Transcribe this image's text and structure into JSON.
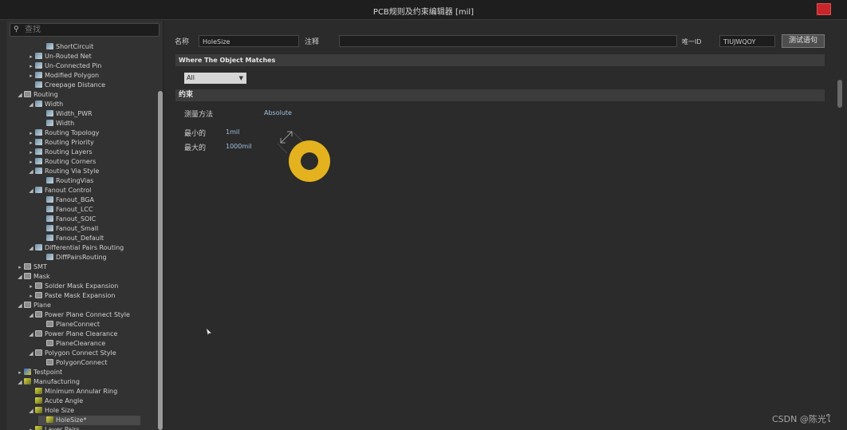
{
  "window": {
    "title": "PCB规则及约束编辑器 [mil]"
  },
  "search": {
    "placeholder": "查找"
  },
  "tree": [
    {
      "label": "ShortCircuit",
      "level": 3,
      "icon": "rule-icon",
      "arrow": ""
    },
    {
      "label": "Un-Routed Net",
      "level": 2,
      "icon": "rule-icon",
      "arrow": "▸"
    },
    {
      "label": "Un-Connected Pin",
      "level": 2,
      "icon": "rule-icon",
      "arrow": "▸"
    },
    {
      "label": "Modified Polygon",
      "level": 2,
      "icon": "rule-icon",
      "arrow": "▸"
    },
    {
      "label": "Creepage Distance",
      "level": 2,
      "icon": "rule-icon",
      "arrow": ""
    },
    {
      "label": "Routing",
      "level": 1,
      "icon": "routing-icon",
      "arrow": "◢"
    },
    {
      "label": "Width",
      "level": 2,
      "icon": "rule-icon",
      "arrow": "◢"
    },
    {
      "label": "Width_PWR",
      "level": 3,
      "icon": "rule-icon",
      "arrow": ""
    },
    {
      "label": "Width",
      "level": 3,
      "icon": "rule-icon",
      "arrow": ""
    },
    {
      "label": "Routing Topology",
      "level": 2,
      "icon": "rule-icon",
      "arrow": "▸"
    },
    {
      "label": "Routing Priority",
      "level": 2,
      "icon": "rule-icon",
      "arrow": "▸"
    },
    {
      "label": "Routing Layers",
      "level": 2,
      "icon": "rule-icon",
      "arrow": "▸"
    },
    {
      "label": "Routing Corners",
      "level": 2,
      "icon": "rule-icon",
      "arrow": "▸"
    },
    {
      "label": "Routing Via Style",
      "level": 2,
      "icon": "rule-icon",
      "arrow": "◢"
    },
    {
      "label": "RoutingVias",
      "level": 3,
      "icon": "rule-icon",
      "arrow": ""
    },
    {
      "label": "Fanout Control",
      "level": 2,
      "icon": "rule-icon",
      "arrow": "◢"
    },
    {
      "label": "Fanout_BGA",
      "level": 3,
      "icon": "rule-icon",
      "arrow": ""
    },
    {
      "label": "Fanout_LCC",
      "level": 3,
      "icon": "rule-icon",
      "arrow": ""
    },
    {
      "label": "Fanout_SOIC",
      "level": 3,
      "icon": "rule-icon",
      "arrow": ""
    },
    {
      "label": "Fanout_Small",
      "level": 3,
      "icon": "rule-icon",
      "arrow": ""
    },
    {
      "label": "Fanout_Default",
      "level": 3,
      "icon": "rule-icon",
      "arrow": ""
    },
    {
      "label": "Differential Pairs Routing",
      "level": 2,
      "icon": "rule-icon",
      "arrow": "◢"
    },
    {
      "label": "DiffPairsRouting",
      "level": 3,
      "icon": "rule-icon",
      "arrow": ""
    },
    {
      "label": "SMT",
      "level": 1,
      "icon": "smt-icon",
      "arrow": "▸"
    },
    {
      "label": "Mask",
      "level": 1,
      "icon": "mask-icon",
      "arrow": "◢"
    },
    {
      "label": "Solder Mask Expansion",
      "level": 2,
      "icon": "mask-icon",
      "arrow": "▸"
    },
    {
      "label": "Paste Mask Expansion",
      "level": 2,
      "icon": "mask-icon",
      "arrow": "▸"
    },
    {
      "label": "Plane",
      "level": 1,
      "icon": "plane-icon",
      "arrow": "◢"
    },
    {
      "label": "Power Plane Connect Style",
      "level": 2,
      "icon": "plane-icon",
      "arrow": "◢"
    },
    {
      "label": "PlaneConnect",
      "level": 3,
      "icon": "plane-icon",
      "arrow": ""
    },
    {
      "label": "Power Plane Clearance",
      "level": 2,
      "icon": "plane-icon",
      "arrow": "◢"
    },
    {
      "label": "PlaneClearance",
      "level": 3,
      "icon": "plane-icon",
      "arrow": ""
    },
    {
      "label": "Polygon Connect Style",
      "level": 2,
      "icon": "plane-icon",
      "arrow": "◢"
    },
    {
      "label": "PolygonConnect",
      "level": 3,
      "icon": "plane-icon",
      "arrow": ""
    },
    {
      "label": "Testpoint",
      "level": 1,
      "icon": "testpoint-icon",
      "arrow": "▸"
    },
    {
      "label": "Manufacturing",
      "level": 1,
      "icon": "manufacturing-icon",
      "arrow": "◢"
    },
    {
      "label": "Minimum Annular Ring",
      "level": 2,
      "icon": "manufacturing-icon",
      "arrow": ""
    },
    {
      "label": "Acute Angle",
      "level": 2,
      "icon": "manufacturing-icon",
      "arrow": ""
    },
    {
      "label": "Hole Size",
      "level": 2,
      "icon": "manufacturing-icon",
      "arrow": "◢"
    },
    {
      "label": "HoleSize*",
      "level": 3,
      "icon": "manufacturing-icon",
      "arrow": "",
      "selected": true
    },
    {
      "label": "Layer Pairs",
      "level": 2,
      "icon": "manufacturing-icon",
      "arrow": "▸"
    }
  ],
  "rule": {
    "name_label": "名称",
    "name_value": "HoleSize",
    "comment_label": "注释",
    "comment_value": "",
    "uid_label": "唯一ID",
    "uid_value": "TIUJWQOY",
    "test_button": "测试语句"
  },
  "match": {
    "title": "Where The Object Matches",
    "scope": "All"
  },
  "constraints": {
    "title": "约束",
    "measure_label": "测量方法",
    "measure_value": "Absolute",
    "min_label": "最小的",
    "min_value": "1mil",
    "max_label": "最大的",
    "max_value": "1000mil"
  },
  "colors": {
    "pad": "#e3b21e",
    "hole": "#2b2b2b",
    "accent": "#9fc0e0"
  },
  "watermark": "CSDN @陈光ใ"
}
